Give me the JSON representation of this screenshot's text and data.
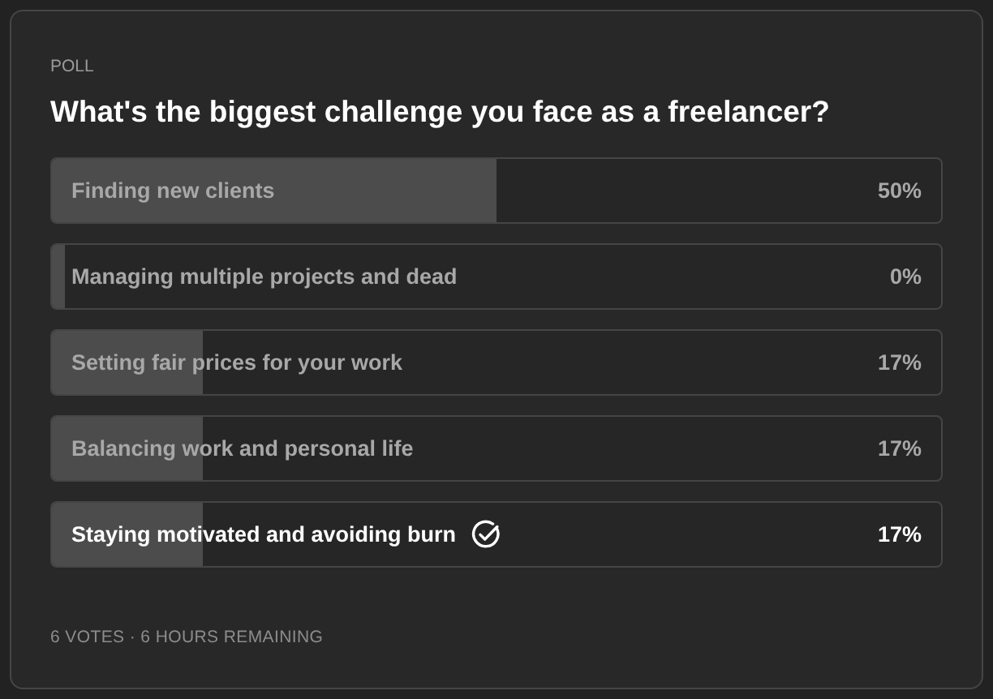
{
  "poll": {
    "label": "POLL",
    "question": "What's the biggest challenge you face as a freelancer?",
    "options": [
      {
        "label": "Finding new clients",
        "percent": "50%",
        "level": 0.5,
        "selected": false
      },
      {
        "label": "Managing multiple projects and dead",
        "percent": "0%",
        "level": 0,
        "selected": false
      },
      {
        "label": "Setting fair prices for your work",
        "percent": "17%",
        "level": 0.17,
        "selected": false
      },
      {
        "label": "Balancing work and personal life",
        "percent": "17%",
        "level": 0.17,
        "selected": false
      },
      {
        "label": "Staying motivated and avoiding burn",
        "percent": "17%",
        "level": 0.17,
        "selected": true
      }
    ],
    "footer": "6 VOTES · 6 HOURS REMAINING"
  }
}
